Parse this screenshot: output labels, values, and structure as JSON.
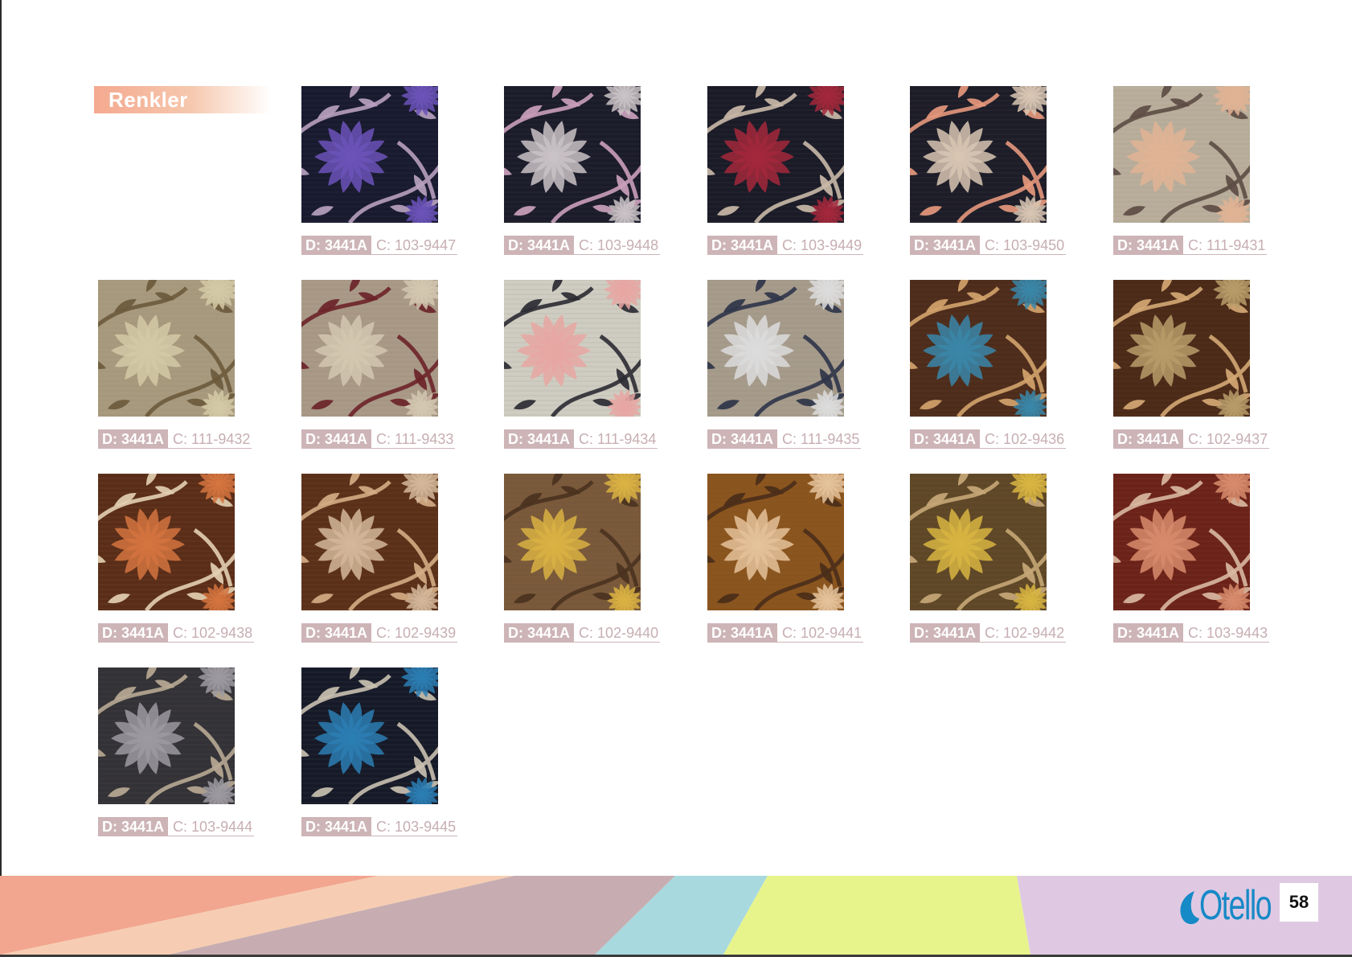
{
  "section_title": "Renkler",
  "swatches": [
    {
      "design": "D: 3441A",
      "color_code": "C: 103-9447",
      "bg": "#181a2e",
      "flower": "#6b54b8",
      "leaf": "#b7a0bf"
    },
    {
      "design": "D: 3441A",
      "color_code": "C: 103-9448",
      "bg": "#1b1c2a",
      "flower": "#c9c2c6",
      "leaf": "#caa0bb"
    },
    {
      "design": "D: 3441A",
      "color_code": "C: 103-9449",
      "bg": "#1a1b27",
      "flower": "#a3283c",
      "leaf": "#c9b9a8"
    },
    {
      "design": "D: 3441A",
      "color_code": "C: 103-9450",
      "bg": "#1c1d28",
      "flower": "#d8c6b3",
      "leaf": "#e5987c"
    },
    {
      "design": "D: 3441A",
      "color_code": "C: 111-9431",
      "bg": "#b9ae9c",
      "flower": "#e0b394",
      "leaf": "#5c4c44"
    },
    {
      "design": "D: 3441A",
      "color_code": "C: 111-9432",
      "bg": "#a89a7e",
      "flower": "#d4c9a6",
      "leaf": "#6b5a3c"
    },
    {
      "design": "D: 3441A",
      "color_code": "C: 111-9433",
      "bg": "#a99a87",
      "flower": "#d2c7b0",
      "leaf": "#6b2429"
    },
    {
      "design": "D: 3441A",
      "color_code": "C: 111-9434",
      "bg": "#cfcdc1",
      "flower": "#e8a6a2",
      "leaf": "#2b2b33"
    },
    {
      "design": "D: 3441A",
      "color_code": "C: 111-9435",
      "bg": "#a79c8b",
      "flower": "#dcdcdc",
      "leaf": "#2f3549"
    },
    {
      "design": "D: 3441A",
      "color_code": "C: 102-9436",
      "bg": "#4d2c1c",
      "flower": "#3a86a8",
      "leaf": "#d3a36b"
    },
    {
      "design": "D: 3441A",
      "color_code": "C: 102-9437",
      "bg": "#4b2a18",
      "flower": "#b79c6a",
      "leaf": "#d4a874"
    },
    {
      "design": "D: 3441A",
      "color_code": "C: 102-9438",
      "bg": "#5a2d18",
      "flower": "#d4743f",
      "leaf": "#e3cfb1"
    },
    {
      "design": "D: 3441A",
      "color_code": "C: 102-9439",
      "bg": "#5b3019",
      "flower": "#d4b79a",
      "leaf": "#d3ad84"
    },
    {
      "design": "D: 3441A",
      "color_code": "C: 102-9440",
      "bg": "#7a5a3b",
      "flower": "#d9b243",
      "leaf": "#4a3220"
    },
    {
      "design": "D: 3441A",
      "color_code": "C: 102-9441",
      "bg": "#8b551f",
      "flower": "#e4c29a",
      "leaf": "#4a2e19"
    },
    {
      "design": "D: 3441A",
      "color_code": "C: 102-9442",
      "bg": "#5e4727",
      "flower": "#d8b542",
      "leaf": "#c7a777"
    },
    {
      "design": "D: 3441A",
      "color_code": "C: 103-9443",
      "bg": "#6b2218",
      "flower": "#d78b6c",
      "leaf": "#d9b8a0"
    },
    {
      "design": "D: 3441A",
      "color_code": "C: 103-9444",
      "bg": "#333236",
      "flower": "#9c9aa0",
      "leaf": "#b7a894"
    },
    {
      "design": "D: 3441A",
      "color_code": "C: 103-9445",
      "bg": "#161a28",
      "flower": "#2b7eb3",
      "leaf": "#c9c0b0"
    }
  ],
  "footer": {
    "brand": "Otello",
    "page_number": "58",
    "stripe_colors": [
      "#f2a58f",
      "#f6cdb2",
      "#c7adb1",
      "#a8d9de",
      "#e7f48c",
      "#dfc9e2"
    ]
  }
}
